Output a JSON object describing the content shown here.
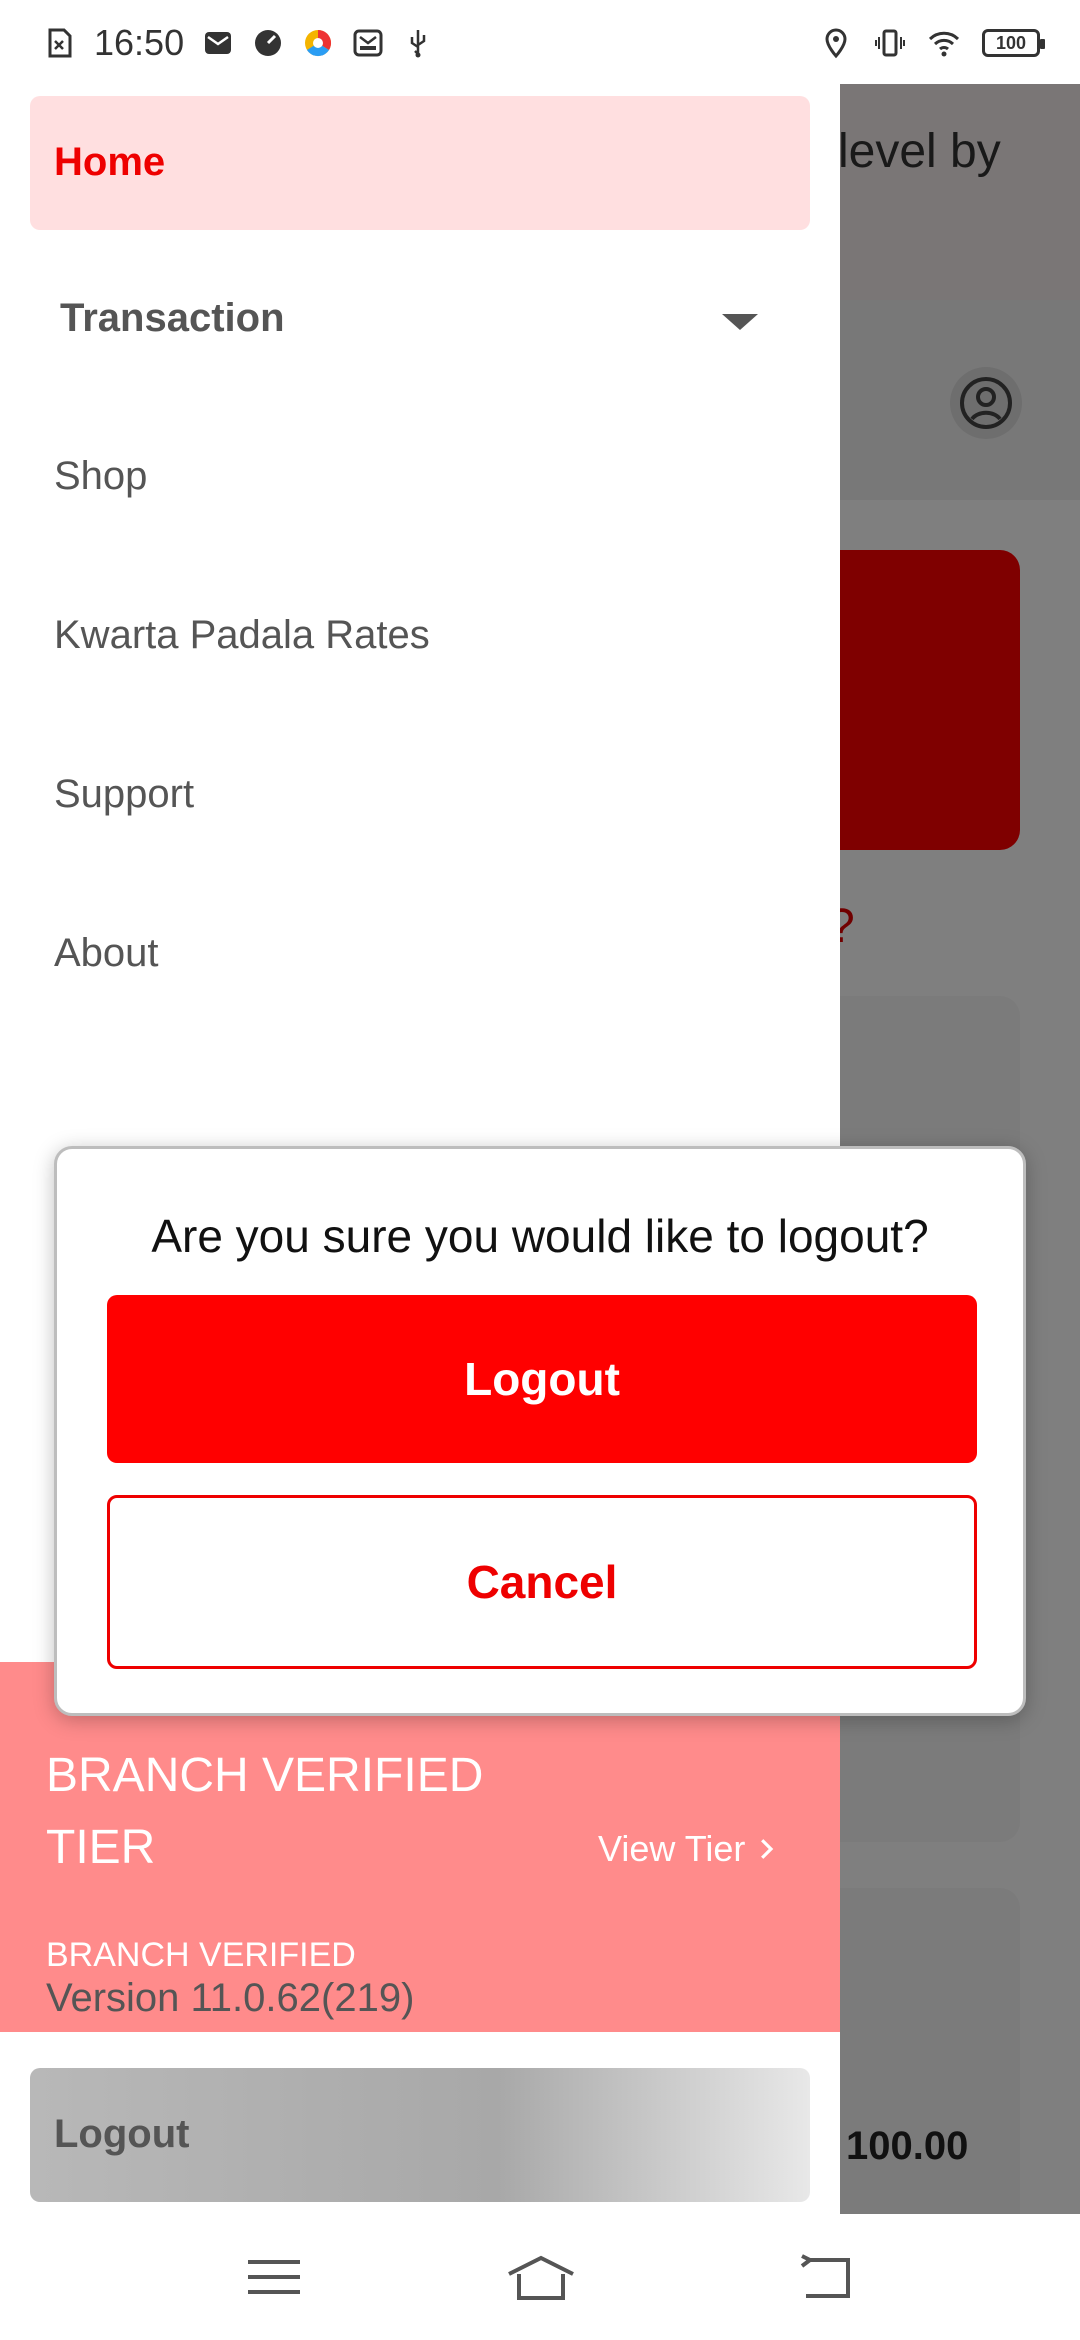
{
  "status_bar": {
    "time": "16:50",
    "battery": "100",
    "icons_left": [
      "sim-card-icon",
      "mail-icon",
      "speed-icon",
      "browser-icon",
      "message-icon",
      "usb-icon"
    ],
    "icons_right": [
      "location-icon",
      "vibrate-icon",
      "wifi-icon",
      "battery-icon"
    ]
  },
  "background": {
    "banner_text": "level by",
    "card_question": "?",
    "amount": "100.00"
  },
  "drawer": {
    "items": [
      {
        "label": "Home",
        "active": true
      },
      {
        "label": "Transaction",
        "expandable": true
      },
      {
        "label": "Shop"
      },
      {
        "label": "Kwarta Padala Rates"
      },
      {
        "label": "Support"
      },
      {
        "label": "About"
      }
    ],
    "tier": {
      "title": "BRANCH VERIFIED TIER",
      "subtitle": "BRANCH VERIFIED",
      "view_label": "View Tier"
    },
    "version": "Version 11.0.62(219)",
    "logout_label": "Logout"
  },
  "dialog": {
    "message": "Are you sure you would like to logout?",
    "confirm_label": "Logout",
    "cancel_label": "Cancel"
  },
  "colors": {
    "accent": "#ff0000",
    "home_highlight": "#ffdfe0",
    "tier_background": "#ff8b8b"
  }
}
